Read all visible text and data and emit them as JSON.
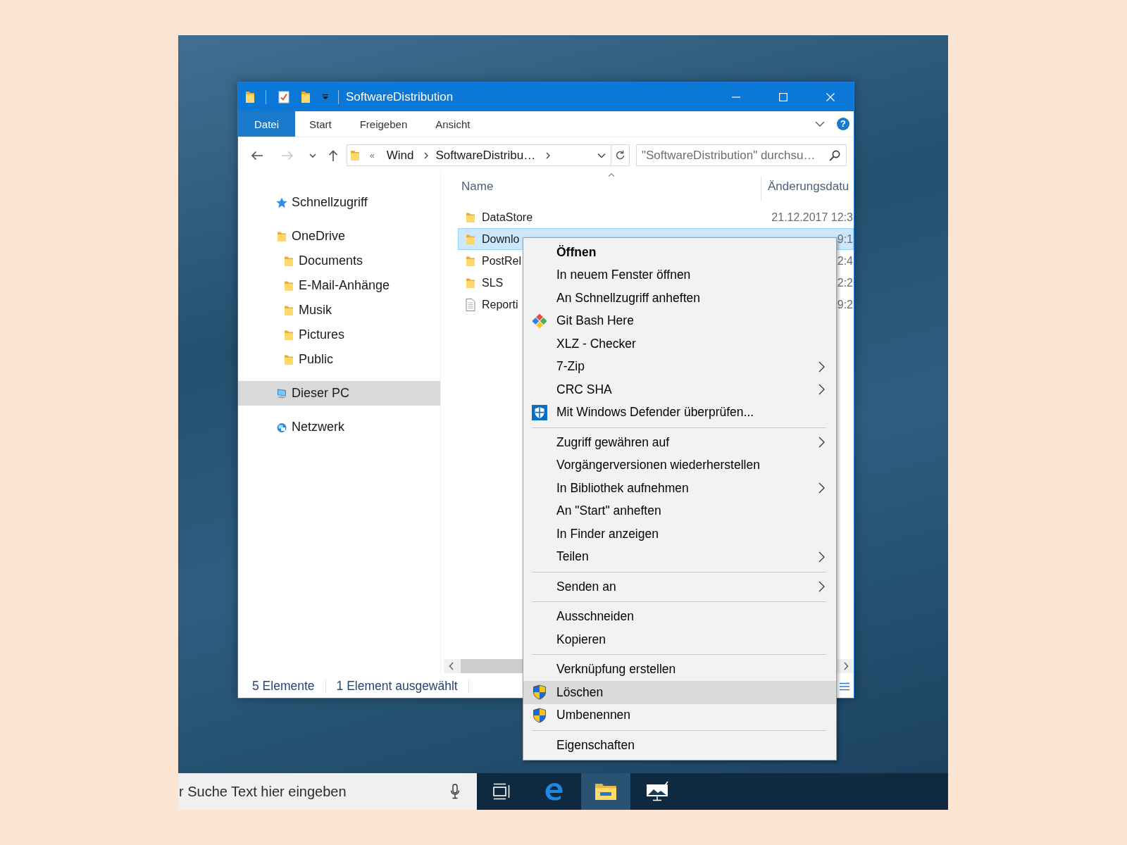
{
  "window": {
    "title": "SoftwareDistribution"
  },
  "ribbon": {
    "tabs": [
      {
        "label": "Datei",
        "kind": "file"
      },
      {
        "label": "Start",
        "kind": "tab"
      },
      {
        "label": "Freigeben",
        "kind": "tab"
      },
      {
        "label": "Ansicht",
        "kind": "tab"
      }
    ],
    "help": "?"
  },
  "address_bar": {
    "buttons": [
      {
        "kind": "back",
        "disabled": false
      },
      {
        "kind": "forward",
        "disabled": true
      },
      {
        "kind": "recent",
        "disabled": false
      },
      {
        "kind": "up",
        "disabled": false
      }
    ],
    "overflow": "«",
    "path": [
      "Wind",
      "SoftwareDistribu…"
    ]
  },
  "search": {
    "placeholder": "\"SoftwareDistribution\" durchsu…"
  },
  "navigation_pane": {
    "items": [
      {
        "label": "Schnellzugriff",
        "kind": "quick_access",
        "selected": false
      },
      {
        "label": "OneDrive",
        "kind": "folder",
        "selected": false,
        "children": [
          {
            "label": "Documents",
            "kind": "folder",
            "selected": false
          },
          {
            "label": "E-Mail-Anhänge",
            "kind": "folder",
            "selected": false
          },
          {
            "label": "Musik",
            "kind": "folder",
            "selected": false
          },
          {
            "label": "Pictures",
            "kind": "folder",
            "selected": false
          },
          {
            "label": "Public",
            "kind": "folder",
            "selected": false
          }
        ]
      },
      {
        "label": "Dieser PC",
        "kind": "this_pc",
        "selected": true
      },
      {
        "label": "Netzwerk",
        "kind": "network",
        "selected": false
      }
    ]
  },
  "file_list": {
    "columns": [
      {
        "label": "Name",
        "sorted": true
      },
      {
        "label": "Änderungsdatu",
        "sorted": false
      }
    ],
    "rows": [
      {
        "name": "DataStore",
        "date": "21.12.2017 12:3",
        "kind": "folder",
        "selected": false
      },
      {
        "name": "Downlo",
        "date": "9:1",
        "kind": "folder",
        "selected": true
      },
      {
        "name": "PostRel",
        "date": "2:4",
        "kind": "folder",
        "selected": false
      },
      {
        "name": "SLS",
        "date": "2:2",
        "kind": "folder",
        "selected": false
      },
      {
        "name": "Reporti",
        "date": "9:2",
        "kind": "file",
        "selected": false
      }
    ]
  },
  "status_bar": {
    "items": [
      "5 Elemente",
      "1 Element ausgewählt"
    ]
  },
  "context_menu": {
    "groups": [
      {
        "items": [
          {
            "label": "Öffnen",
            "kind": "plain",
            "default": true,
            "submenu": false,
            "selected": false
          },
          {
            "label": "In neuem Fenster öffnen",
            "kind": "plain",
            "default": false,
            "submenu": false,
            "selected": false
          },
          {
            "label": "An Schnellzugriff anheften",
            "kind": "plain",
            "default": false,
            "submenu": false,
            "selected": false
          },
          {
            "label": "Git Bash Here",
            "kind": "git",
            "default": false,
            "submenu": false,
            "selected": false
          },
          {
            "label": "XLZ - Checker",
            "kind": "plain",
            "default": false,
            "submenu": false,
            "selected": false
          },
          {
            "label": "7-Zip",
            "kind": "plain",
            "default": false,
            "submenu": true,
            "selected": false
          },
          {
            "label": "CRC SHA",
            "kind": "plain",
            "default": false,
            "submenu": true,
            "selected": false
          },
          {
            "label": "Mit Windows Defender überprüfen...",
            "kind": "scan",
            "default": false,
            "submenu": false,
            "selected": false
          }
        ]
      },
      {
        "items": [
          {
            "label": "Zugriff gewähren auf",
            "kind": "plain",
            "default": false,
            "submenu": true,
            "selected": false
          },
          {
            "label": "Vorgängerversionen wiederherstellen",
            "kind": "plain",
            "default": false,
            "submenu": false,
            "selected": false
          },
          {
            "label": "In Bibliothek aufnehmen",
            "kind": "plain",
            "default": false,
            "submenu": true,
            "selected": false
          },
          {
            "label": "An \"Start\" anheften",
            "kind": "plain",
            "default": false,
            "submenu": false,
            "selected": false
          },
          {
            "label": "In Finder anzeigen",
            "kind": "plain",
            "default": false,
            "submenu": false,
            "selected": false
          },
          {
            "label": "Teilen",
            "kind": "plain",
            "default": false,
            "submenu": true,
            "selected": false
          }
        ]
      },
      {
        "items": [
          {
            "label": "Senden an",
            "kind": "plain",
            "default": false,
            "submenu": true,
            "selected": false
          }
        ]
      },
      {
        "items": [
          {
            "label": "Ausschneiden",
            "kind": "plain",
            "default": false,
            "submenu": false,
            "selected": false
          },
          {
            "label": "Kopieren",
            "kind": "plain",
            "default": false,
            "submenu": false,
            "selected": false
          }
        ]
      },
      {
        "items": [
          {
            "label": "Verknüpfung erstellen",
            "kind": "plain",
            "default": false,
            "submenu": false,
            "selected": false
          },
          {
            "label": "Löschen",
            "kind": "elevated",
            "default": false,
            "submenu": false,
            "selected": true
          },
          {
            "label": "Umbenennen",
            "kind": "elevated",
            "default": false,
            "submenu": false,
            "selected": false
          }
        ]
      },
      {
        "items": [
          {
            "label": "Eigenschaften",
            "kind": "plain",
            "default": false,
            "submenu": false,
            "selected": false
          }
        ]
      }
    ]
  },
  "taskbar": {
    "search": {
      "placeholder": "r Suche Text hier eingeben"
    },
    "apps": [
      {
        "kind": "task_view",
        "selected": false
      },
      {
        "kind": "browser",
        "selected": false
      },
      {
        "kind": "file_explorer",
        "selected": true
      },
      {
        "kind": "sketch",
        "selected": false
      }
    ]
  }
}
